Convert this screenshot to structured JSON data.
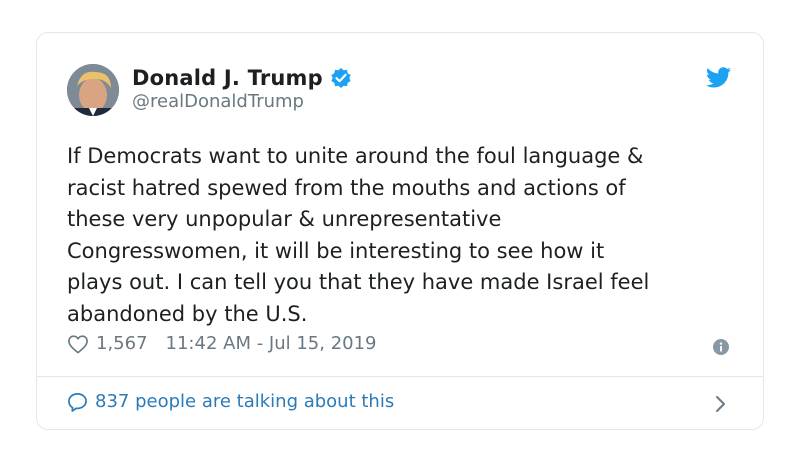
{
  "tweet": {
    "author_name": "Donald J. Trump",
    "author_handle": "@realDonaldTrump",
    "text": "If Democrats want to unite around the foul language &\nracist hatred spewed from the mouths and actions of\nthese very unpopular & unrepresentative\nCongresswomen, it will be interesting to see how it\nplays out. I can tell you that they have made Israel feel\nabandoned by the U.S.",
    "like_count": "1,567",
    "timestamp": "11:42 AM - Jul 15, 2019",
    "talking_text": "837 people are talking about this"
  },
  "colors": {
    "verified_badge": "#1da1f2",
    "twitter_bird": "#1da1f2",
    "link": "#2b7bb9",
    "meta_text": "#697882",
    "border": "#e1e8ed"
  },
  "icons": [
    "avatar",
    "verified-badge-icon",
    "twitter-bird-icon",
    "heart-icon",
    "info-icon",
    "speech-bubble-icon",
    "chevron-right-icon"
  ]
}
